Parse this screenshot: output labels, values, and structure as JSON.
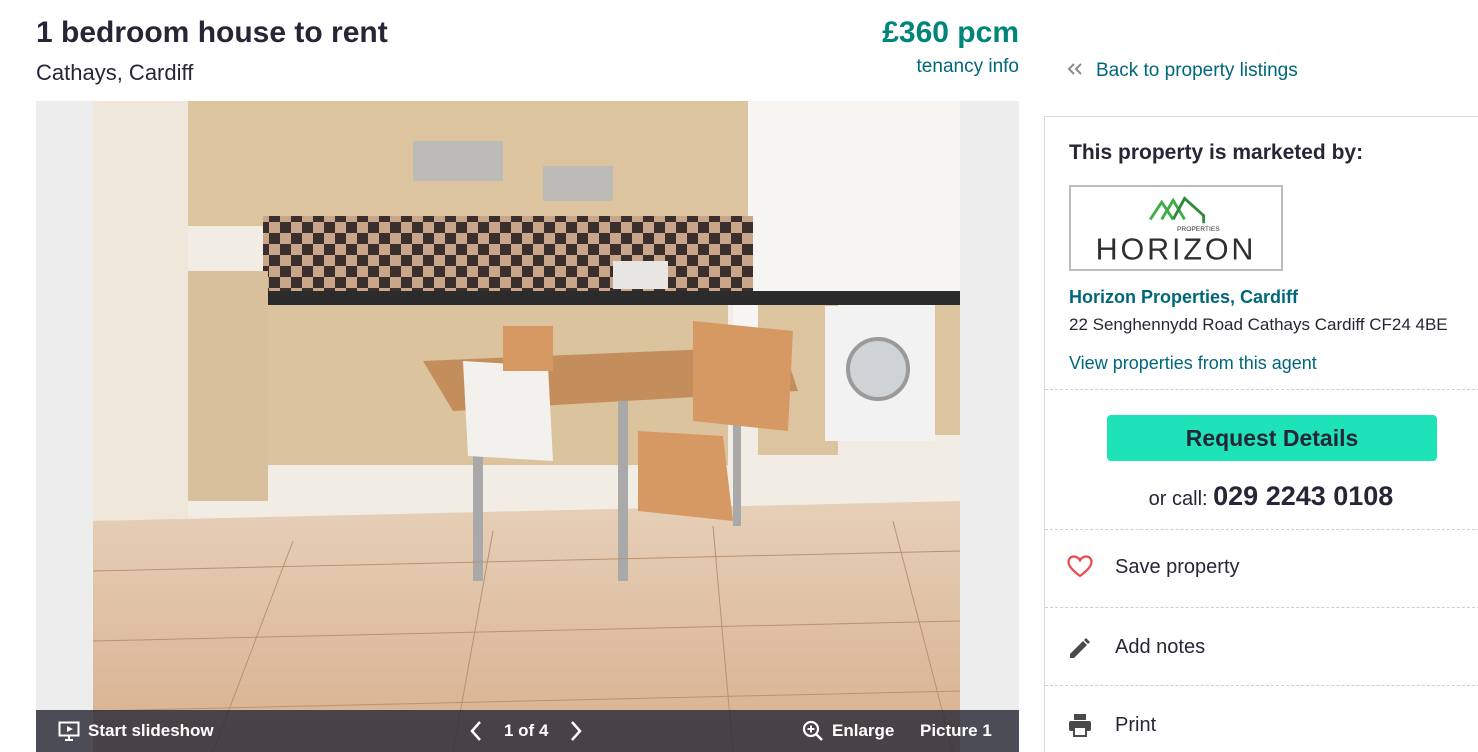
{
  "listing": {
    "title": "1 bedroom house to rent",
    "location": "Cathays, Cardiff",
    "price": "£360 pcm",
    "tenancy_link": "tenancy info"
  },
  "gallery": {
    "slideshow_label": "Start slideshow",
    "counter": "1 of 4",
    "enlarge_label": "Enlarge",
    "picture_label": "Picture 1"
  },
  "sidebar": {
    "back_link": "Back to property listings",
    "marketed_by": "This property is marketed by:",
    "agent": {
      "logo_small_text": "PROPERTIES",
      "logo_main_text": "HORIZON",
      "name": "Horizon Properties, Cardiff",
      "address": "22 Senghennydd Road Cathays Cardiff CF24 4BE",
      "view_link": "View properties from this agent"
    },
    "request_button": "Request Details",
    "call_prefix": "or call:",
    "phone": "029 2243 0108",
    "actions": {
      "save": "Save property",
      "notes": "Add notes",
      "print": "Print"
    }
  },
  "colors": {
    "price": "#00857a",
    "link": "#00677a",
    "request_button": "#1ee3b8",
    "heart": "#e8484f",
    "logo_green": "#3fae49"
  },
  "icons": [
    "chevron-double-left-icon",
    "slideshow-icon",
    "chevron-left-icon",
    "chevron-right-icon",
    "zoom-in-icon",
    "heart-icon",
    "pencil-icon",
    "printer-icon"
  ]
}
